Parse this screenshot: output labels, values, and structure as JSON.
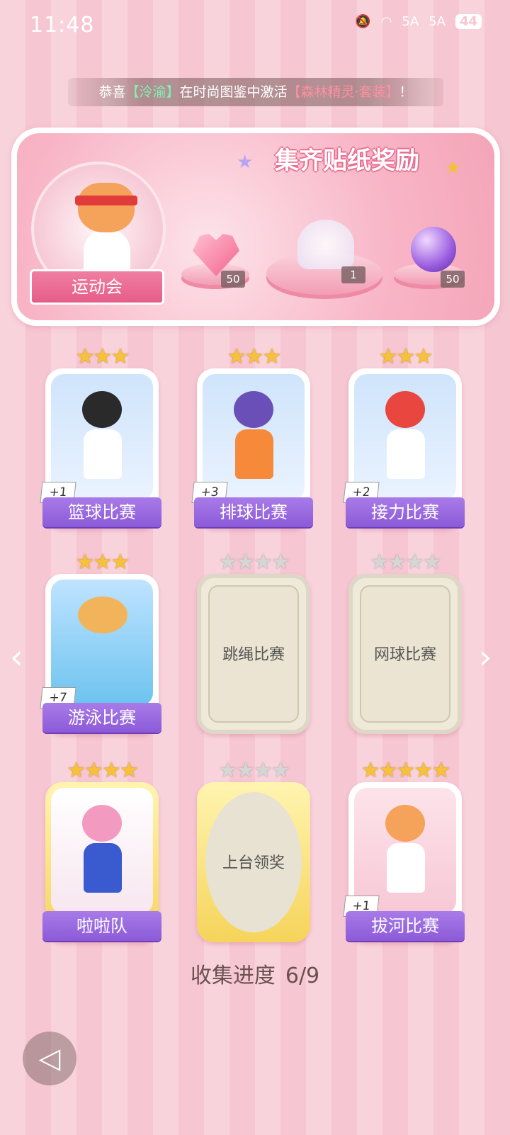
{
  "status_bar": {
    "time": "11:48",
    "signal1": "5A",
    "signal2": "5A",
    "battery": "44"
  },
  "ticker": {
    "prefix": "恭喜",
    "player": "【泠渝】",
    "middle": "在时尚图鉴中激活",
    "item": "【森林精灵·套装】",
    "suffix": "！"
  },
  "banner": {
    "title": "集齐贴纸奖励",
    "event_name": "运动会",
    "rewards": [
      {
        "name": "heart-gem",
        "count": "50"
      },
      {
        "name": "jellyfish",
        "count": "1"
      },
      {
        "name": "purple-orb",
        "count": "50"
      }
    ]
  },
  "stickers": [
    {
      "label": "篮球比赛",
      "plus": "+1",
      "stars": "★★★",
      "state": "collected"
    },
    {
      "label": "排球比赛",
      "plus": "+3",
      "stars": "★★★",
      "state": "collected"
    },
    {
      "label": "接力比赛",
      "plus": "+2",
      "stars": "★★★",
      "state": "collected"
    },
    {
      "label": "游泳比赛",
      "plus": "+7",
      "stars": "★★★",
      "state": "collected"
    },
    {
      "label": "跳绳比赛",
      "plus": "",
      "stars": "★★★★",
      "state": "locked"
    },
    {
      "label": "网球比赛",
      "plus": "",
      "stars": "★★★★",
      "state": "locked"
    },
    {
      "label": "啦啦队",
      "plus": "",
      "stars": "★★★★",
      "state": "collected"
    },
    {
      "label": "上台领奖",
      "plus": "",
      "stars": "★★★★",
      "state": "locked"
    },
    {
      "label": "拔河比赛",
      "plus": "+1",
      "stars": "★★★★★",
      "state": "collected"
    }
  ],
  "progress": {
    "label": "收集进度",
    "value": "6/9"
  },
  "nav": {
    "prev": "‹",
    "next": "›",
    "back": "◁"
  }
}
